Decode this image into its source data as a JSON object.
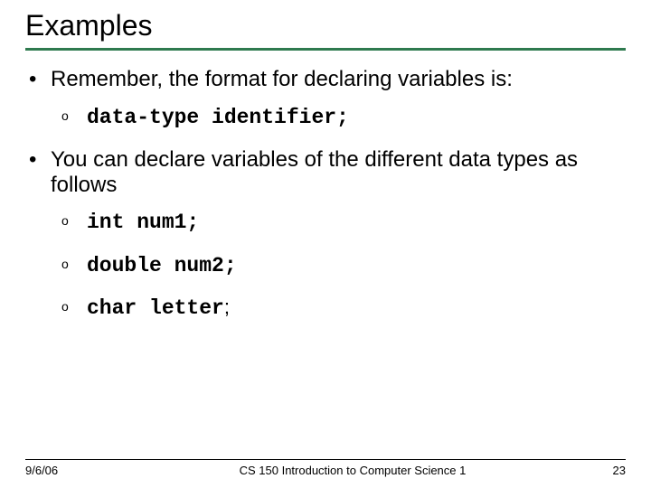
{
  "title": "Examples",
  "bullets": [
    {
      "text": "Remember, the format for declaring variables is:",
      "sub": [
        {
          "code": "data-type identifier;"
        }
      ]
    },
    {
      "text": "You can declare variables of the different data types as follows",
      "sub": [
        {
          "code": "int num1;"
        },
        {
          "code": "double num2;"
        },
        {
          "code": "char letter",
          "tail": ";"
        }
      ]
    }
  ],
  "footer": {
    "date": "9/6/06",
    "course": "CS 150 Introduction to Computer Science 1",
    "page": "23"
  }
}
